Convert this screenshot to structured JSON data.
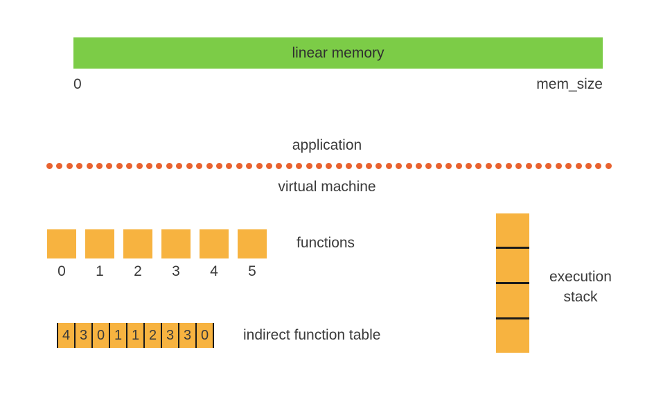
{
  "linear_memory": {
    "label": "linear memory",
    "start_label": "0",
    "end_label": "mem_size"
  },
  "divider": {
    "top_label": "application",
    "bottom_label": "virtual machine",
    "dot_count": 57
  },
  "functions": {
    "label": "functions",
    "indices": [
      "0",
      "1",
      "2",
      "3",
      "4",
      "5"
    ]
  },
  "indirect_function_table": {
    "label": "indirect function table",
    "cells": [
      "4",
      "3",
      "0",
      "1",
      "1",
      "2",
      "3",
      "3",
      "0"
    ]
  },
  "execution_stack": {
    "label_line1": "execution",
    "label_line2": "stack",
    "cell_count": 4
  }
}
